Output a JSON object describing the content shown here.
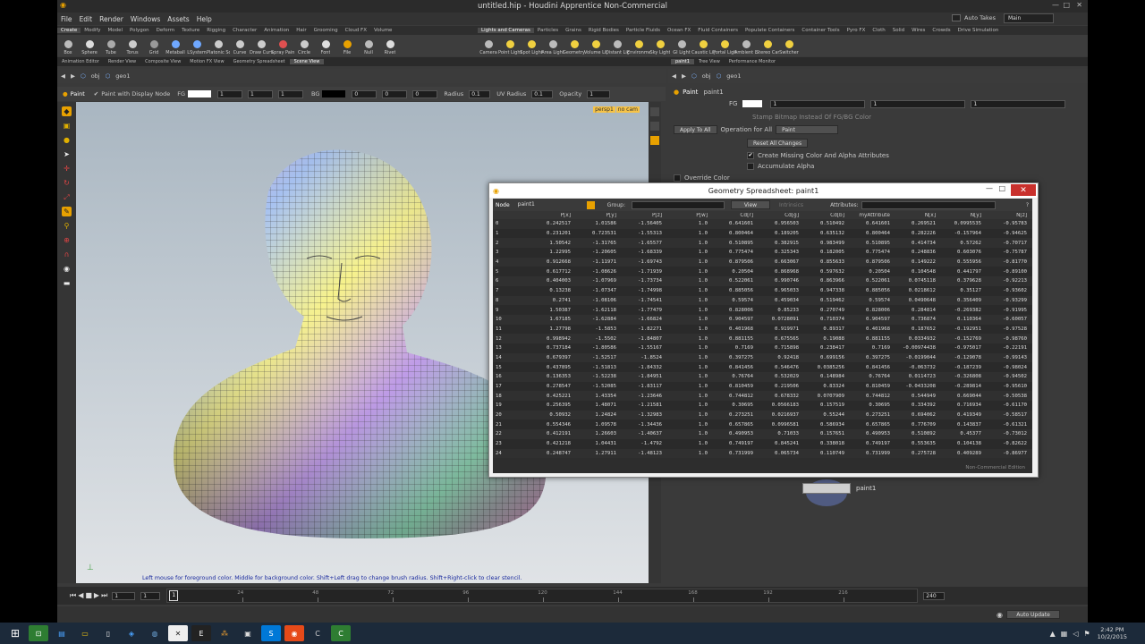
{
  "window": {
    "title": "untitled.hip - Houdini Apprentice Non-Commercial",
    "auto_takes": "Auto Takes",
    "desktop": "Main"
  },
  "menu": [
    "File",
    "Edit",
    "Render",
    "Windows",
    "Assets",
    "Help"
  ],
  "shelf_tabs_left": [
    "Create",
    "Modify",
    "Model",
    "Polygon",
    "Deform",
    "Texture",
    "Rigging",
    "Character",
    "Animation",
    "Hair",
    "Grooming",
    "Cloud FX",
    "Volume"
  ],
  "shelf_tools_left": [
    "Box",
    "Sphere",
    "Tube",
    "Torus",
    "Grid",
    "Metaball",
    "LSystem",
    "Platonic Sol...",
    "Curve",
    "Draw Curve",
    "Spray Paint",
    "Circle",
    "Font",
    "File",
    "Null",
    "Rivet"
  ],
  "shelf_tabs_right": [
    "Lights and Cameras",
    "Particles",
    "Grains",
    "Rigid Bodies",
    "Particle Fluids",
    "Ocean FX",
    "Fluid Containers",
    "Populate Containers",
    "Container Tools",
    "Pyro FX",
    "Cloth",
    "Solid",
    "Wires",
    "Crowds",
    "Drive Simulation"
  ],
  "shelf_tools_right": [
    "Camera",
    "Point Light",
    "Spot Light",
    "Area Light",
    "Geometry L...",
    "Volume Light",
    "Distant Light",
    "Environmen...",
    "Sky Light",
    "GI Light",
    "Caustic Light",
    "Portal Light",
    "Ambient Lig...",
    "Stereo Cam...",
    "Switcher"
  ],
  "pane_tabs_left": [
    "Animation Editor",
    "Render View",
    "Composite View",
    "Motion FX View",
    "Geometry Spreadsheet",
    "Scene View"
  ],
  "pane_tabs_right": [
    "paint1",
    "Tree View",
    "Performance Monitor"
  ],
  "path": {
    "obj": "obj",
    "geo": "geo1"
  },
  "paint_toolbar": {
    "paint_label": "Paint",
    "display_node": "Paint with Display Node",
    "fg": "FG",
    "fg_v1": "1",
    "fg_v2": "1",
    "fg_v3": "1",
    "bg": "BG",
    "bg_v1": "0",
    "bg_v2": "0",
    "bg_v3": "0",
    "radius_label": "Radius",
    "radius": "0.1",
    "uv_radius_label": "UV Radius",
    "uv_radius": "0.1",
    "opacity_label": "Opacity",
    "opacity": "1"
  },
  "viewport": {
    "camera_tag": "persp1",
    "cam_tag": "no cam",
    "hint": "Left mouse for foreground color. Middle for background color. Shift+Left drag to change brush radius. Shift+Right-click to clear stencil."
  },
  "params": {
    "node_type": "Paint",
    "node_name": "paint1",
    "fg_label": "FG",
    "fg_v1": "1",
    "fg_v2": "1",
    "fg_v3": "1",
    "stamp": "Stamp Bitmap Instead Of FG/BG Color",
    "apply_all": "Apply To All",
    "op_label": "Operation for All",
    "op_value": "Paint",
    "reset": "Reset All Changes",
    "create_missing": "Create Missing Color And Alpha Attributes",
    "accumulate": "Accumulate Alpha",
    "override": "Override Color"
  },
  "network": {
    "node_label": "paint1"
  },
  "spreadsheet": {
    "title": "Geometry Spreadsheet: paint1",
    "node_label": "Node",
    "node": "paint1",
    "group_label": "Group:",
    "view": "View",
    "intrinsics": "Intrinsics",
    "attributes": "Attributes:",
    "watermark": "Non-Commercial Edition",
    "columns": [
      "",
      "P[x]",
      "P[y]",
      "P[z]",
      "P[w]",
      "Cd[r]",
      "Cd[g]",
      "Cd[b]",
      "myAttribute",
      "N[x]",
      "N[y]",
      "N[z]"
    ],
    "rows": [
      [
        "0",
        "0.242517",
        "1.01586",
        "-1.56405",
        "1.0",
        "0.641601",
        "0.956503",
        "0.510492",
        "0.641601",
        "0.269521",
        "0.0995535",
        "-0.95783"
      ],
      [
        "1",
        "0.231201",
        "0.723531",
        "-1.55313",
        "1.0",
        "0.800464",
        "0.189205",
        "0.635132",
        "0.800464",
        "0.282226",
        "-0.157964",
        "-0.94625"
      ],
      [
        "2",
        "1.50542",
        "-1.31765",
        "-1.65577",
        "1.0",
        "0.510895",
        "0.382915",
        "0.983499",
        "0.510895",
        "0.414734",
        "0.57262",
        "-0.70717"
      ],
      [
        "3",
        "1.22995",
        "-1.20605",
        "-1.68339",
        "1.0",
        "0.775474",
        "0.325343",
        "0.182005",
        "0.775474",
        "0.248836",
        "0.603076",
        "-0.75787"
      ],
      [
        "4",
        "0.912668",
        "-1.11971",
        "-1.69743",
        "1.0",
        "0.879506",
        "0.663067",
        "0.855633",
        "0.879506",
        "0.149222",
        "0.555956",
        "-0.81770"
      ],
      [
        "5",
        "0.617712",
        "-1.08626",
        "-1.71939",
        "1.0",
        "0.20504",
        "0.868968",
        "0.597632",
        "0.20504",
        "0.104548",
        "0.441797",
        "-0.89100"
      ],
      [
        "6",
        "0.404003",
        "-1.07969",
        "-1.73734",
        "1.0",
        "0.522061",
        "0.990746",
        "0.863966",
        "0.522061",
        "0.0745118",
        "0.379628",
        "-0.92213"
      ],
      [
        "7",
        "0.13238",
        "-1.07347",
        "-1.74998",
        "1.0",
        "0.885056",
        "0.965033",
        "0.947338",
        "0.885056",
        "0.0218612",
        "0.35127",
        "-0.93602"
      ],
      [
        "8",
        "0.2741",
        "-1.08106",
        "-1.74541",
        "1.0",
        "0.59574",
        "0.459034",
        "0.519462",
        "0.59574",
        "0.0490648",
        "0.356409",
        "-0.93299"
      ],
      [
        "9",
        "1.50387",
        "-1.62118",
        "-1.77479",
        "1.0",
        "0.828006",
        "0.85233",
        "0.270749",
        "0.828006",
        "0.284814",
        "-0.269382",
        "-0.91995"
      ],
      [
        "10",
        "1.67185",
        "-1.62884",
        "-1.66824",
        "1.0",
        "0.904597",
        "0.0728091",
        "0.710374",
        "0.904597",
        "0.736874",
        "0.110364",
        "-0.60057"
      ],
      [
        "11",
        "1.27798",
        "-1.5853",
        "-1.82271",
        "1.0",
        "0.401968",
        "0.919971",
        "0.89317",
        "0.401968",
        "0.187652",
        "-0.192951",
        "-0.97528"
      ],
      [
        "12",
        "0.998942",
        "-1.5502",
        "-1.84807",
        "1.0",
        "0.881155",
        "0.675565",
        "0.19088",
        "0.881155",
        "0.0334932",
        "-0.152769",
        "-0.98760"
      ],
      [
        "13",
        "0.737184",
        "-1.80586",
        "-1.55167",
        "1.0",
        "0.7169",
        "0.715898",
        "0.238417",
        "0.7169",
        "-0.00974438",
        "-0.975017",
        "-0.22191"
      ],
      [
        "14",
        "0.679397",
        "-1.52517",
        "-1.8524",
        "1.0",
        "0.397275",
        "0.92418",
        "0.699156",
        "0.397275",
        "-0.0199044",
        "-0.129078",
        "-0.99143"
      ],
      [
        "15",
        "0.437895",
        "-1.51813",
        "-1.84332",
        "1.0",
        "0.841456",
        "0.546476",
        "0.0385256",
        "0.841456",
        "-0.063732",
        "-0.187239",
        "-0.98024"
      ],
      [
        "16",
        "0.136353",
        "-1.52238",
        "-1.84951",
        "1.0",
        "0.76764",
        "0.532029",
        "0.148984",
        "0.76764",
        "0.0114723",
        "-0.326808",
        "-0.94502"
      ],
      [
        "17",
        "0.278547",
        "-1.52085",
        "-1.83117",
        "1.0",
        "0.810459",
        "0.219506",
        "0.83324",
        "0.810459",
        "-0.0433208",
        "-0.289814",
        "-0.95610"
      ],
      [
        "18",
        "0.425221",
        "1.43354",
        "-1.23646",
        "1.0",
        "0.744812",
        "0.678332",
        "0.0707909",
        "0.744812",
        "0.544949",
        "0.669044",
        "-0.50538"
      ],
      [
        "19",
        "0.256395",
        "1.48071",
        "-1.21581",
        "1.0",
        "0.30695",
        "0.0566183",
        "0.157519",
        "0.30695",
        "0.334392",
        "0.716934",
        "-0.61170"
      ],
      [
        "20",
        "0.50932",
        "1.24824",
        "-1.32983",
        "1.0",
        "0.273251",
        "0.0216937",
        "0.55244",
        "0.273251",
        "0.694062",
        "0.419349",
        "-0.58517"
      ],
      [
        "21",
        "0.554346",
        "1.09578",
        "-1.34436",
        "1.0",
        "0.657865",
        "0.0996581",
        "0.586934",
        "0.657865",
        "0.776709",
        "0.143837",
        "-0.61321"
      ],
      [
        "22",
        "0.412191",
        "1.26603",
        "-1.40637",
        "1.0",
        "0.490953",
        "0.71033",
        "0.157651",
        "0.490953",
        "0.510892",
        "0.45377",
        "-0.73012"
      ],
      [
        "23",
        "0.421218",
        "1.04431",
        "-1.4792",
        "1.0",
        "0.749197",
        "0.845241",
        "0.338018",
        "0.749197",
        "0.553635",
        "0.104138",
        "-0.82622"
      ],
      [
        "24",
        "0.248747",
        "1.27911",
        "-1.48123",
        "1.0",
        "0.731999",
        "0.065734",
        "0.110749",
        "0.731999",
        "0.275728",
        "0.409289",
        "-0.86977"
      ]
    ]
  },
  "timeline": {
    "ticks": [
      "24",
      "48",
      "72",
      "96",
      "120",
      "144",
      "168",
      "192",
      "216"
    ],
    "frame": "1",
    "start": "1",
    "end_frame": "1",
    "range_end": "240"
  },
  "status": {
    "auto_update": "Auto Update"
  },
  "taskbar": {
    "time": "2:42 PM",
    "date": "10/2/2015"
  },
  "colors": {
    "accent": "#e8a100",
    "selected": "#f6c347",
    "close": "#c9302c",
    "hint_text": "#1a2a9e"
  }
}
